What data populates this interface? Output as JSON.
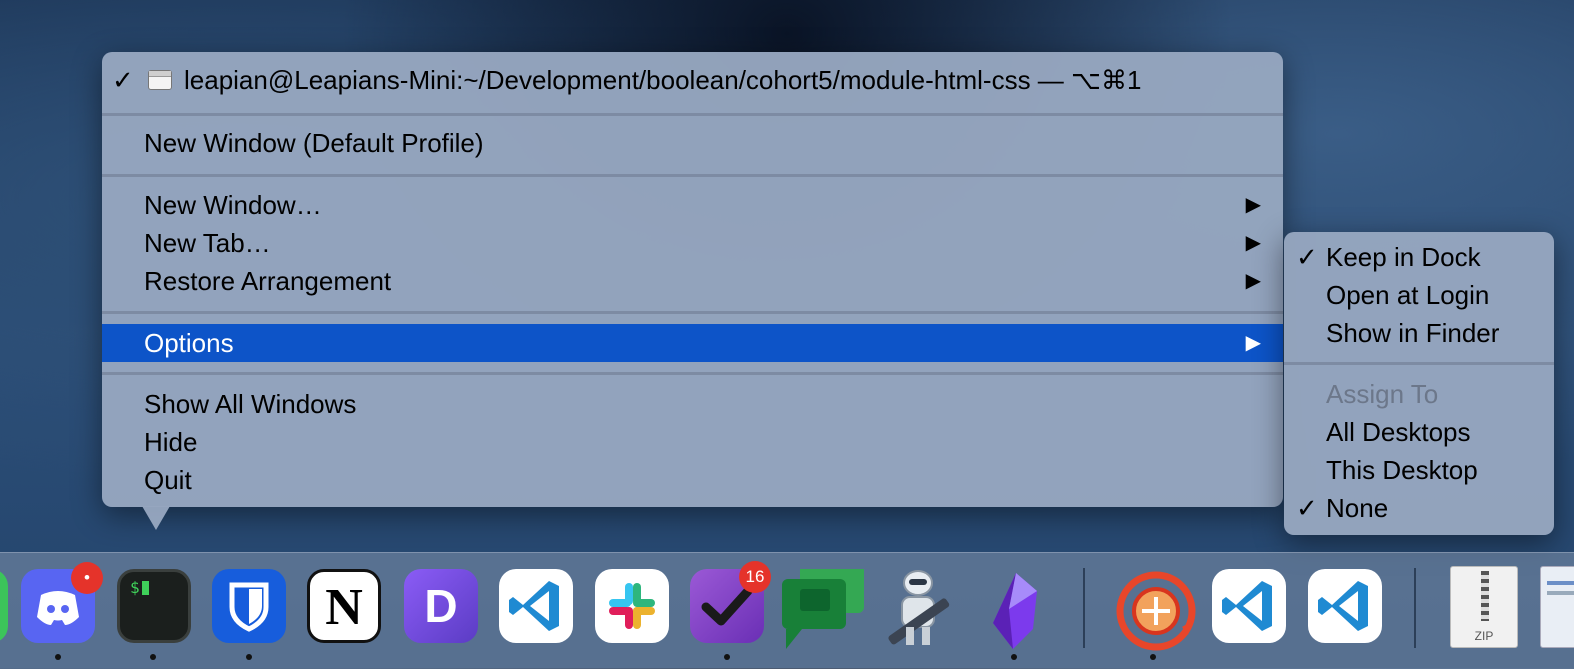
{
  "menu": {
    "window_title": "leapian@Leapians-Mini:~/Development/boolean/cohort5/module-html-css — ⌥⌘1",
    "window_checked": "✓",
    "items": [
      {
        "label": "New Window (Default Profile)"
      },
      {
        "label": "New Window…",
        "arrow": "▶"
      },
      {
        "label": "New Tab…",
        "arrow": "▶"
      },
      {
        "label": "Restore Arrangement",
        "arrow": "▶"
      },
      {
        "label": "Options",
        "arrow": "▶",
        "highlighted": true
      },
      {
        "label": "Show All Windows"
      },
      {
        "label": "Hide"
      },
      {
        "label": "Quit"
      }
    ]
  },
  "submenu": {
    "check": "✓",
    "items": [
      {
        "label": "Keep in Dock",
        "checked": true
      },
      {
        "label": "Open at Login",
        "checked": false
      },
      {
        "label": "Show in Finder",
        "checked": false
      }
    ],
    "section_header": "Assign To",
    "assign": [
      {
        "label": "All Desktops",
        "checked": false
      },
      {
        "label": "This Desktop",
        "checked": false
      },
      {
        "label": "None",
        "checked": true
      }
    ]
  },
  "dock": {
    "apps": [
      {
        "name": "discord-icon",
        "badge": "•",
        "running": true
      },
      {
        "name": "terminal-icon",
        "glyph": "$",
        "running": true
      },
      {
        "name": "bitwarden-icon",
        "running": true
      },
      {
        "name": "notion-icon",
        "glyph": "N",
        "running": false
      },
      {
        "name": "dash-icon",
        "glyph": "D",
        "running": false
      },
      {
        "name": "vscode-icon",
        "running": false
      },
      {
        "name": "slack-icon",
        "running": false
      },
      {
        "name": "omnifocus-icon",
        "badge": "16",
        "running": true
      },
      {
        "name": "google-chat-icon",
        "running": false
      },
      {
        "name": "automator-icon",
        "running": false
      },
      {
        "name": "obsidian-icon",
        "running": true
      },
      {
        "name": "time-machine-icon",
        "running": true
      },
      {
        "name": "vscode-icon-2",
        "running": false
      },
      {
        "name": "vscode-icon-3",
        "running": false
      },
      {
        "name": "zip-file-icon",
        "label": "ZIP"
      },
      {
        "name": "document-icon"
      }
    ],
    "colors": {
      "accent": "#0d54c8",
      "badge": "#e5332a"
    }
  }
}
